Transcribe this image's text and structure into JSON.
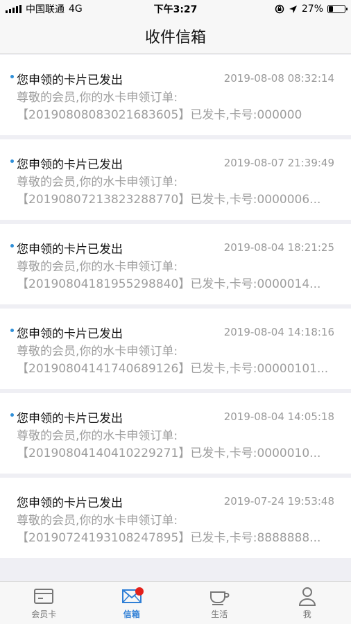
{
  "status": {
    "carrier": "中国联通",
    "network": "4G",
    "time": "下午3:27",
    "battery_text": "27%",
    "battery_level": 0.27
  },
  "nav": {
    "title": "收件信箱"
  },
  "messages": [
    {
      "title": "您申领的卡片已发出",
      "time": "2019-08-08 08:32:14",
      "line1": "尊敬的会员,你的水卡申领订单:",
      "line2": "【20190808083021683605】已发卡,卡号:000000",
      "unread": true
    },
    {
      "title": "您申领的卡片已发出",
      "time": "2019-08-07 21:39:49",
      "line1": "尊敬的会员,你的水卡申领订单:",
      "line2": "【20190807213823288770】已发卡,卡号:0000006...",
      "unread": true
    },
    {
      "title": "您申领的卡片已发出",
      "time": "2019-08-04 18:21:25",
      "line1": "尊敬的会员,你的水卡申领订单:",
      "line2": "【20190804181955298840】已发卡,卡号:0000014...",
      "unread": true
    },
    {
      "title": "您申领的卡片已发出",
      "time": "2019-08-04 14:18:16",
      "line1": "尊敬的会员,你的水卡申领订单:",
      "line2": "【20190804141740689126】已发卡,卡号:00000101...",
      "unread": true
    },
    {
      "title": "您申领的卡片已发出",
      "time": "2019-08-04 14:05:18",
      "line1": "尊敬的会员,你的水卡申领订单:",
      "line2": "【20190804140410229271】已发卡,卡号:0000010...",
      "unread": true
    },
    {
      "title": "您申领的卡片已发出",
      "time": "2019-07-24 19:53:48",
      "line1": "尊敬的会员,你的水卡申领订单:",
      "line2": "【20190724193108247895】已发卡,卡号:8888888...",
      "unread": false
    }
  ],
  "tabs": [
    {
      "label": "会员卡",
      "icon": "card-icon",
      "active": false
    },
    {
      "label": "信箱",
      "icon": "mail-icon",
      "active": true
    },
    {
      "label": "生活",
      "icon": "cup-icon",
      "active": false
    },
    {
      "label": "我",
      "icon": "person-icon",
      "active": false
    }
  ],
  "colors": {
    "accent": "#2f7fd6",
    "badge": "#e3201b",
    "unread_dot": "#2f8fd8"
  }
}
